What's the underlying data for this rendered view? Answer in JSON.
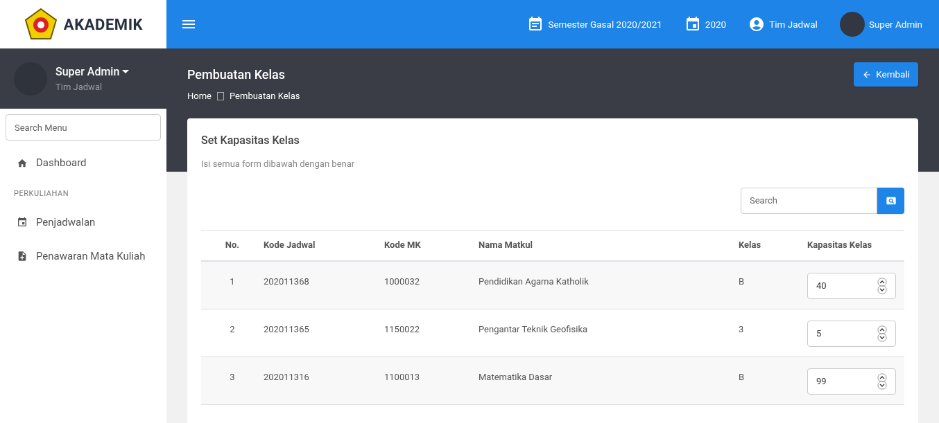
{
  "brand": {
    "title": "AKADEMIK"
  },
  "topbar": {
    "items": [
      {
        "kind": "semester",
        "label": "Semester Gasal 2020/2021"
      },
      {
        "kind": "year",
        "label": "2020"
      },
      {
        "kind": "role",
        "label": "Tim Jadwal"
      },
      {
        "kind": "user",
        "label": "Super Admin"
      }
    ]
  },
  "profile": {
    "name": "Super Admin",
    "role": "Tim Jadwal"
  },
  "sidebar": {
    "search": {
      "placeholder": "Search Menu"
    },
    "items": [
      {
        "kind": "link",
        "label": "Dashboard"
      },
      {
        "kind": "heading",
        "label": "PERKULIAHAN"
      },
      {
        "kind": "link",
        "label": "Penjadwalan"
      },
      {
        "kind": "link",
        "label": "Penawaran Mata Kuliah"
      }
    ]
  },
  "page": {
    "title": "Pembuatan Kelas",
    "breadcrumb": [
      "Home",
      "Pembuatan Kelas"
    ],
    "back_button": "Kembali"
  },
  "card": {
    "title": "Set Kapasitas Kelas",
    "subtitle": "Isi semua form dibawah dengan benar",
    "search": {
      "placeholder": "Search"
    },
    "table": {
      "columns": [
        "No.",
        "Kode Jadwal",
        "Kode MK",
        "Nama Matkul",
        "Kelas",
        "Kapasitas Kelas"
      ],
      "rows": [
        {
          "no": "1",
          "kode_jadwal": "202011368",
          "kode_mk": "1000032",
          "nama": "Pendidikan Agama Katholik",
          "kelas": "B",
          "kapasitas": "40"
        },
        {
          "no": "2",
          "kode_jadwal": "202011365",
          "kode_mk": "1150022",
          "nama": "Pengantar Teknik Geofisika",
          "kelas": "3",
          "kapasitas": "5"
        },
        {
          "no": "3",
          "kode_jadwal": "202011316",
          "kode_mk": "1100013",
          "nama": "Matematika Dasar",
          "kelas": "B",
          "kapasitas": "99"
        }
      ]
    }
  }
}
